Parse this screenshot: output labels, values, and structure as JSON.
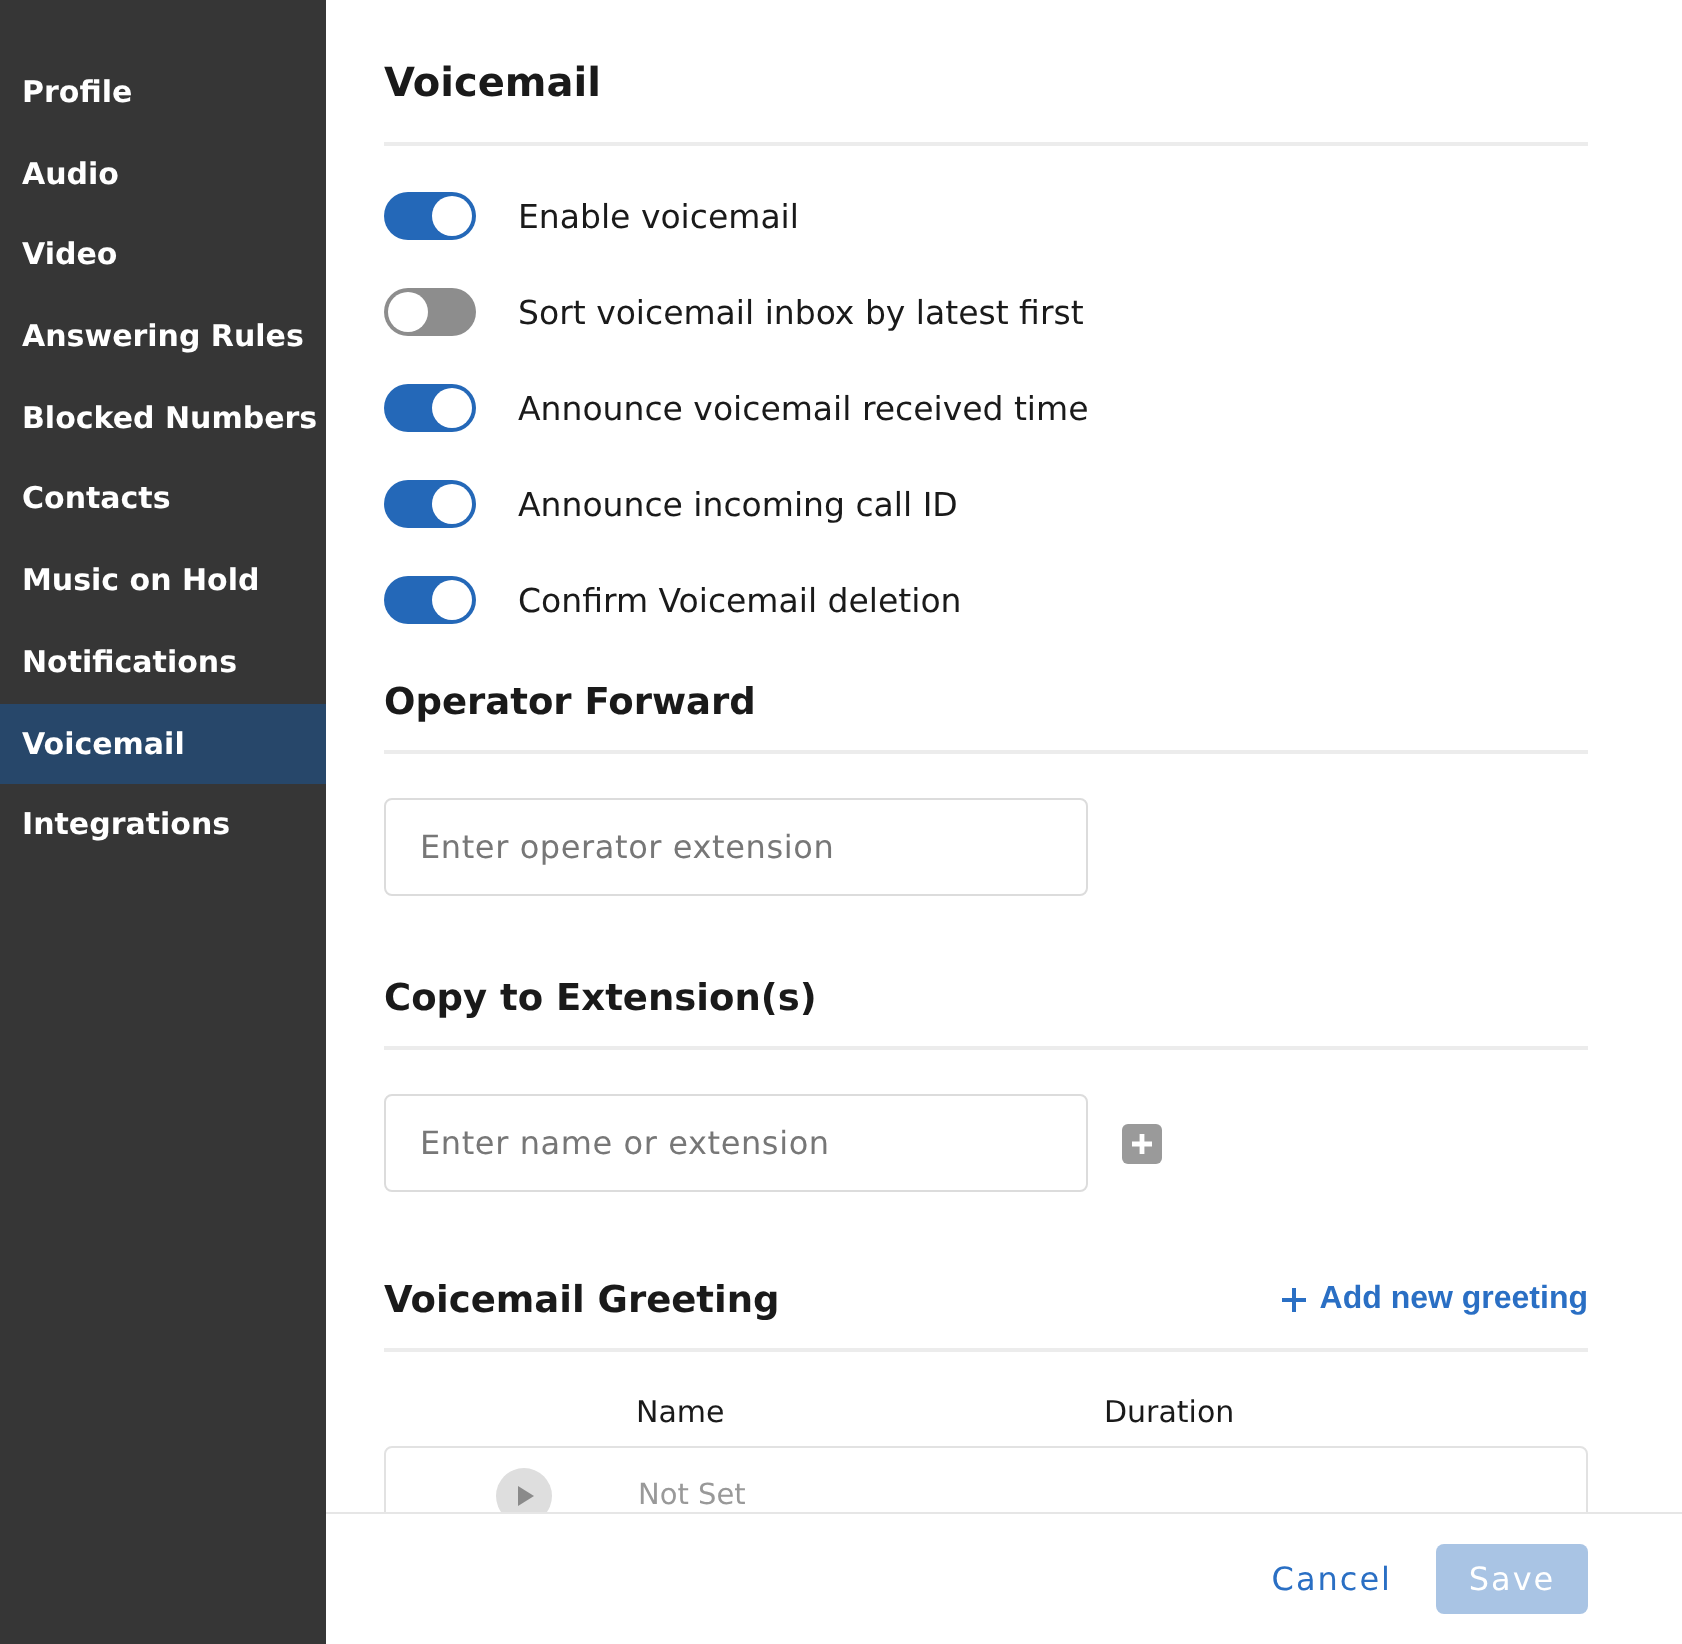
{
  "sidebar": {
    "items": [
      {
        "label": "Profile",
        "selected": false
      },
      {
        "label": "Audio",
        "selected": false
      },
      {
        "label": "Video",
        "selected": false
      },
      {
        "label": "Answering Rules",
        "selected": false
      },
      {
        "label": "Blocked Numbers",
        "selected": false
      },
      {
        "label": "Contacts",
        "selected": false
      },
      {
        "label": "Music on Hold",
        "selected": false
      },
      {
        "label": "Notifications",
        "selected": false
      },
      {
        "label": "Voicemail",
        "selected": true
      },
      {
        "label": "Integrations",
        "selected": false
      }
    ]
  },
  "title": "Voicemail",
  "toggles": [
    {
      "label": "Enable voicemail",
      "on": true
    },
    {
      "label": "Sort voicemail inbox by latest first",
      "on": false
    },
    {
      "label": "Announce voicemail received time",
      "on": true
    },
    {
      "label": "Announce incoming call ID",
      "on": true
    },
    {
      "label": "Confirm Voicemail deletion",
      "on": true
    }
  ],
  "operator_forward": {
    "heading": "Operator Forward",
    "placeholder": "Enter operator extension"
  },
  "copy_to_extension": {
    "heading": "Copy to Extension(s)",
    "placeholder": "Enter name or extension"
  },
  "greeting": {
    "heading": "Voicemail Greeting",
    "add_link": "Add new greeting",
    "columns": [
      "Name",
      "Duration"
    ],
    "rows": [
      {
        "name": "Not Set"
      }
    ]
  },
  "footer": {
    "cancel": "Cancel",
    "save": "Save"
  }
}
